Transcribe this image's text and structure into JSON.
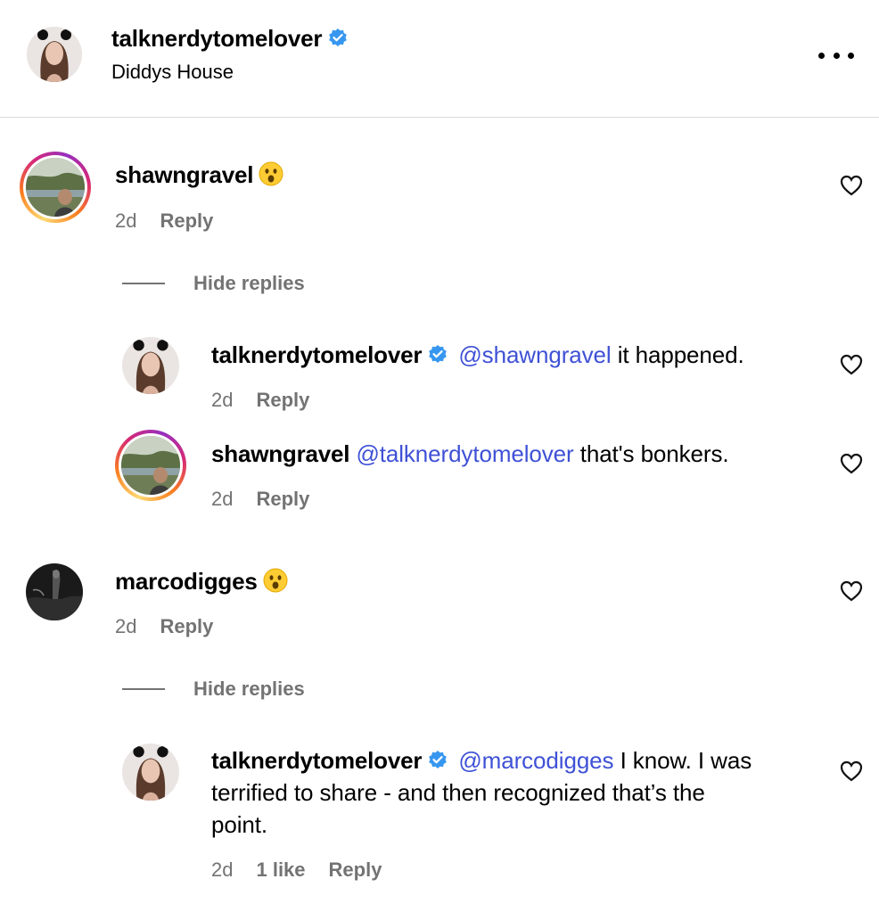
{
  "post": {
    "author": "talknerdytomelover",
    "location": "Diddys House"
  },
  "labels": {
    "reply": "Reply",
    "hide_replies": "Hide replies"
  },
  "comments": [
    {
      "username": "shawngravel",
      "emoji": "😮",
      "time": "2d",
      "replies": [
        {
          "username": "talknerdytomelover",
          "verified": true,
          "mention": "@shawngravel",
          "text": "it happened.",
          "time": "2d"
        },
        {
          "username": "shawngravel",
          "verified": false,
          "mention": "@talknerdytomelover",
          "text": "that's bonkers.",
          "time": "2d"
        }
      ]
    },
    {
      "username": "marcodigges",
      "emoji": "😮",
      "time": "2d",
      "replies": [
        {
          "username": "talknerdytomelover",
          "verified": true,
          "mention": "@marcodigges",
          "text_line1": "I know. I was",
          "text_line2": "terrified to share - and then recognized that’s the",
          "text_line3": "point.",
          "time": "2d",
          "likes": "1 like"
        }
      ]
    }
  ],
  "colors": {
    "verified": "#3797f0",
    "mention": "#3f51d6",
    "meta": "#737373",
    "divider": "#dbdbdb"
  },
  "icons": [
    "more-options-icon",
    "verified-icon",
    "heart-icon"
  ]
}
